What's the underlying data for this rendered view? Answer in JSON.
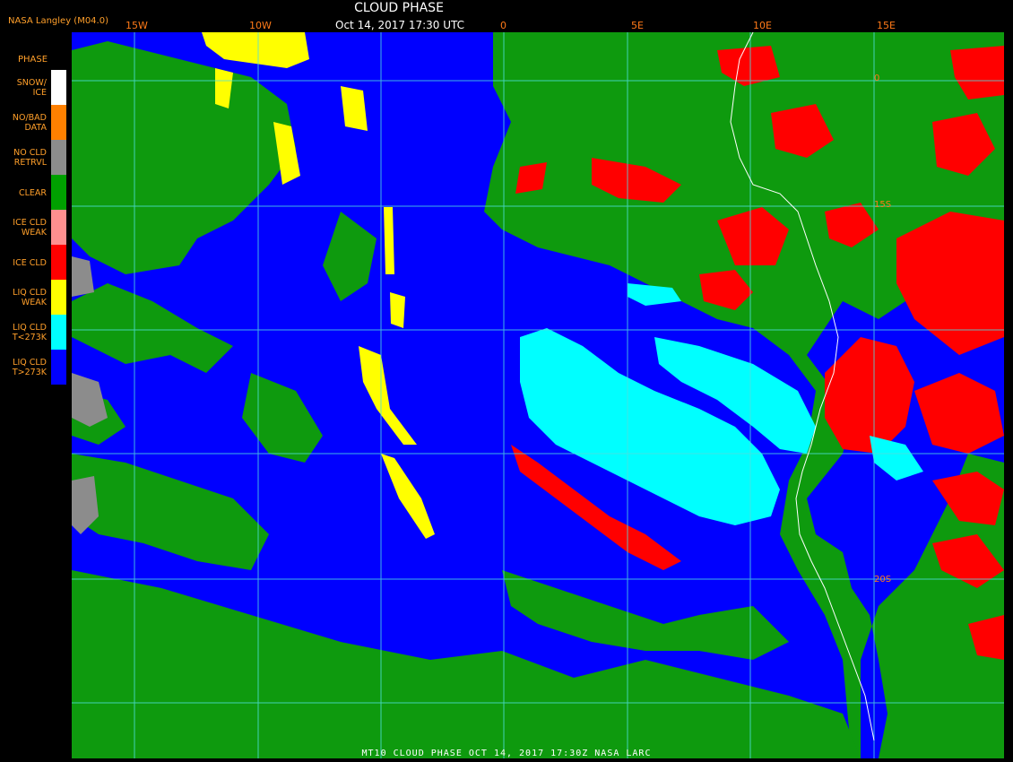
{
  "header": {
    "source": "NASA Langley (M04.0)",
    "title": "CLOUD PHASE",
    "datetime": "Oct 14, 2017 17:30 UTC"
  },
  "grid": {
    "lon_labels": [
      "15W",
      "10W",
      "0",
      "5E",
      "10E",
      "15E"
    ],
    "lat_labels": [
      "0",
      "15S",
      "20S"
    ]
  },
  "legend": {
    "heading": "PHASE",
    "items": [
      {
        "label": "SNOW/\nICE",
        "color": "#ffffff"
      },
      {
        "label": "NO/BAD\nDATA",
        "color": "#ff8000"
      },
      {
        "label": "NO CLD\nRETRVL",
        "color": "#8c8c8c"
      },
      {
        "label": "CLEAR",
        "color": "#00a000"
      },
      {
        "label": "ICE CLD\nWEAK",
        "color": "#ff8f8f"
      },
      {
        "label": "ICE CLD",
        "color": "#ff0000"
      },
      {
        "label": "LIQ CLD\nWEAK",
        "color": "#ffff00"
      },
      {
        "label": "LIQ CLD\nT<273K",
        "color": "#00ffff"
      },
      {
        "label": "LIQ CLD\nT>273K",
        "color": "#0000ff"
      }
    ]
  },
  "colors": {
    "liq_warm": "#0000ff",
    "clear": "#0e9a0e",
    "ice": "#ff0000",
    "liq_cold": "#00ffff",
    "liq_weak": "#ffff00",
    "no_retrieval": "#8c8c8c",
    "coastline": "#ffffff",
    "gridline": "#4fe0e0"
  },
  "footer": {
    "text": "MT10  CLOUD PHASE  OCT 14, 2017 17:30Z  NASA LARC"
  }
}
